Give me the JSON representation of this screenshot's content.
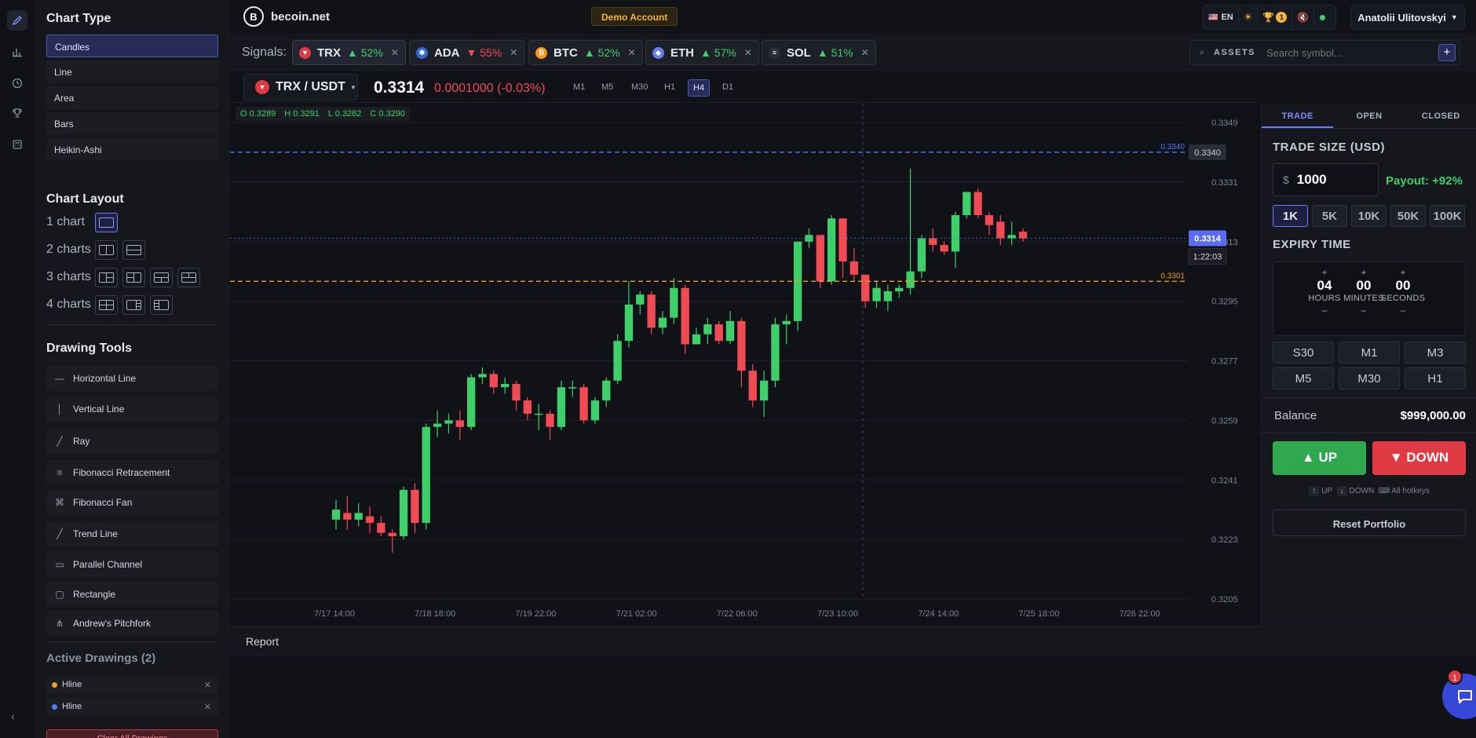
{
  "brand": {
    "name": "becoin.net",
    "logo_letter": "B"
  },
  "header": {
    "demo_label": "Demo Account",
    "language": "EN",
    "flag": "🇺🇸",
    "theme_icon": "sun-icon",
    "trophy_count": "1",
    "user_name": "Anatolii Ulitovskyi"
  },
  "left_rail": {
    "items": [
      "pencil-icon",
      "bar-chart-icon",
      "clock-icon",
      "trophy-icon",
      "calculator-icon"
    ]
  },
  "chart_type": {
    "title": "Chart Type",
    "items": [
      "Candles",
      "Line",
      "Area",
      "Bars",
      "Heikin-Ashi"
    ],
    "selected": "Candles"
  },
  "chart_layout": {
    "title": "Chart Layout",
    "rows": [
      "1 chart",
      "2 charts",
      "3 charts",
      "4 charts"
    ]
  },
  "drawing_tools": {
    "title": "Drawing Tools",
    "items": [
      {
        "label": "Horizontal Line",
        "icon": "—"
      },
      {
        "label": "Vertical Line",
        "icon": "│"
      },
      {
        "label": "Ray",
        "icon": "╱"
      },
      {
        "label": "Fibonacci Retracement",
        "icon": "≡"
      },
      {
        "label": "Fibonacci Fan",
        "icon": "⌘"
      },
      {
        "label": "Trend Line",
        "icon": "╱"
      },
      {
        "label": "Parallel Channel",
        "icon": "▭"
      },
      {
        "label": "Rectangle",
        "icon": "▢"
      },
      {
        "label": "Andrew's Pitchfork",
        "icon": "⋔"
      }
    ]
  },
  "active_drawings": {
    "title": "Active Drawings (2)",
    "items": [
      {
        "label": "Hline",
        "color": "#f0a020"
      },
      {
        "label": "Hline",
        "color": "#4a7dff"
      }
    ],
    "clear_label": "Clear All Drawings"
  },
  "signals": {
    "label": "Signals:",
    "chips": [
      {
        "symbol": "TRX",
        "pct": "52%",
        "dir": "up",
        "arrow": "▲",
        "color": "#e03b44",
        "glyph": "▼",
        "selected": true
      },
      {
        "symbol": "ADA",
        "pct": "55%",
        "dir": "down",
        "arrow": "▼",
        "color": "#3468d1",
        "glyph": "✱",
        "selected": false
      },
      {
        "symbol": "BTC",
        "pct": "52%",
        "dir": "up",
        "arrow": "▲",
        "color": "#f7931a",
        "glyph": "₿",
        "selected": false
      },
      {
        "symbol": "ETH",
        "pct": "57%",
        "dir": "up",
        "arrow": "▲",
        "color": "#627eea",
        "glyph": "◆",
        "selected": false
      },
      {
        "symbol": "SOL",
        "pct": "51%",
        "dir": "up",
        "arrow": "▲",
        "color": "#2a2d3a",
        "glyph": "≡",
        "selected": false
      }
    ]
  },
  "search": {
    "label": "ASSETS",
    "placeholder": "Search symbol..."
  },
  "pair": {
    "name": "TRX / USDT",
    "price": "0.3314",
    "change": "0.0001000 (-0.03%)",
    "timeframes": [
      "M1",
      "M5",
      "M30",
      "H1",
      "H4",
      "D1"
    ],
    "selected_tf": "H4"
  },
  "ohlc": {
    "o": "O 0.3289",
    "h": "H 0.3291",
    "l": "L 0.3282",
    "c": "C 0.3290"
  },
  "chart_data": {
    "type": "candlestick",
    "price_axis_ticks": [
      "0.3349",
      "0.3331",
      "0.3313",
      "0.3295",
      "0.3277",
      "0.3259",
      "0.3241",
      "0.3223",
      "0.3205"
    ],
    "time_axis_ticks": [
      "7/17 14:00",
      "7/18 18:00",
      "7/19 22:00",
      "7/21 02:00",
      "7/22 06:00",
      "7/23 10:00",
      "7/24 14:00",
      "7/25 18:00",
      "7/26 22:00"
    ],
    "y_range": [
      0.3205,
      0.3349
    ],
    "last_price": "0.3314",
    "countdown": "1:22:03",
    "hlines": [
      {
        "value": 0.334,
        "label": "0.3340",
        "color": "#4a7dff"
      },
      {
        "value": 0.3301,
        "label": "0.3301",
        "color": "#f0a020"
      }
    ],
    "candles": [
      [
        0.3229,
        0.3232,
        0.3235,
        0.3226
      ],
      [
        0.3231,
        0.3229,
        0.3236,
        0.3226
      ],
      [
        0.3229,
        0.3231,
        0.3234,
        0.3227
      ],
      [
        0.323,
        0.3228,
        0.3233,
        0.3225
      ],
      [
        0.3228,
        0.3225,
        0.323,
        0.3224
      ],
      [
        0.3225,
        0.3224,
        0.3226,
        0.3219
      ],
      [
        0.3224,
        0.3238,
        0.3239,
        0.3223
      ],
      [
        0.3238,
        0.3228,
        0.324,
        0.3225
      ],
      [
        0.3228,
        0.3257,
        0.3258,
        0.3226
      ],
      [
        0.3257,
        0.3258,
        0.3262,
        0.3254
      ],
      [
        0.3258,
        0.3259,
        0.3261,
        0.3255
      ],
      [
        0.3259,
        0.3257,
        0.3262,
        0.3253
      ],
      [
        0.3257,
        0.3272,
        0.3273,
        0.3256
      ],
      [
        0.3272,
        0.3273,
        0.3275,
        0.327
      ],
      [
        0.3273,
        0.3269,
        0.3274,
        0.3267
      ],
      [
        0.3269,
        0.327,
        0.3272,
        0.3267
      ],
      [
        0.327,
        0.3265,
        0.3271,
        0.3262
      ],
      [
        0.3265,
        0.3261,
        0.3266,
        0.3259
      ],
      [
        0.3261,
        0.3261,
        0.3264,
        0.3256
      ],
      [
        0.3261,
        0.3257,
        0.3262,
        0.3253
      ],
      [
        0.3257,
        0.3269,
        0.3271,
        0.3256
      ],
      [
        0.3269,
        0.3269,
        0.3271,
        0.3266
      ],
      [
        0.3269,
        0.3259,
        0.327,
        0.3258
      ],
      [
        0.3259,
        0.3265,
        0.3266,
        0.3258
      ],
      [
        0.3265,
        0.3271,
        0.3272,
        0.3263
      ],
      [
        0.3271,
        0.3283,
        0.3285,
        0.327
      ],
      [
        0.3283,
        0.3294,
        0.3301,
        0.3281
      ],
      [
        0.3294,
        0.3297,
        0.3298,
        0.3291
      ],
      [
        0.3297,
        0.3287,
        0.3298,
        0.3285
      ],
      [
        0.3287,
        0.329,
        0.3292,
        0.3285
      ],
      [
        0.329,
        0.3299,
        0.3302,
        0.3288
      ],
      [
        0.3299,
        0.3282,
        0.33,
        0.3279
      ],
      [
        0.3282,
        0.3285,
        0.3287,
        0.3283
      ],
      [
        0.3285,
        0.3288,
        0.329,
        0.3282
      ],
      [
        0.3288,
        0.3283,
        0.3289,
        0.3282
      ],
      [
        0.3283,
        0.3289,
        0.3292,
        0.3282
      ],
      [
        0.3289,
        0.3274,
        0.329,
        0.3269
      ],
      [
        0.3274,
        0.3265,
        0.3276,
        0.3263
      ],
      [
        0.3265,
        0.3271,
        0.3274,
        0.326
      ],
      [
        0.3271,
        0.3288,
        0.329,
        0.3269
      ],
      [
        0.3288,
        0.3289,
        0.3291,
        0.3282
      ],
      [
        0.3289,
        0.3313,
        0.3313,
        0.3286
      ],
      [
        0.3313,
        0.3315,
        0.3317,
        0.3311
      ],
      [
        0.3315,
        0.3301,
        0.3315,
        0.3299
      ],
      [
        0.3301,
        0.332,
        0.3321,
        0.33
      ],
      [
        0.332,
        0.3307,
        0.332,
        0.3302
      ],
      [
        0.3307,
        0.3303,
        0.3311,
        0.3301
      ],
      [
        0.3303,
        0.3295,
        0.3303,
        0.3293
      ],
      [
        0.3295,
        0.3299,
        0.3301,
        0.3293
      ],
      [
        0.3295,
        0.3298,
        0.33,
        0.3292
      ],
      [
        0.3298,
        0.3299,
        0.33,
        0.3296
      ],
      [
        0.3299,
        0.3304,
        0.3335,
        0.3297
      ],
      [
        0.3304,
        0.3314,
        0.3315,
        0.3302
      ],
      [
        0.3314,
        0.3312,
        0.3317,
        0.331
      ],
      [
        0.3312,
        0.331,
        0.3313,
        0.3309
      ],
      [
        0.331,
        0.3321,
        0.3322,
        0.3305
      ],
      [
        0.3321,
        0.3328,
        0.3328,
        0.332
      ],
      [
        0.3328,
        0.3321,
        0.3329,
        0.332
      ],
      [
        0.3321,
        0.3318,
        0.3322,
        0.3315
      ],
      [
        0.3319,
        0.3314,
        0.3321,
        0.3312
      ],
      [
        0.3314,
        0.3315,
        0.3319,
        0.3312
      ],
      [
        0.3316,
        0.3314,
        0.3317,
        0.3313
      ]
    ]
  },
  "trade_panel": {
    "tabs": [
      "TRADE",
      "OPEN",
      "CLOSED"
    ],
    "selected_tab": "TRADE",
    "size_title": "TRADE SIZE (USD)",
    "currency": "$",
    "amount": "1000",
    "payout": "Payout: +92%",
    "quick": [
      "1K",
      "5K",
      "10K",
      "50K",
      "100K"
    ],
    "selected_quick": "1K",
    "expiry_title": "EXPIRY TIME",
    "expiry": {
      "hours": "04",
      "minutes": "00",
      "seconds": "00",
      "hours_label": "HOURS",
      "minutes_label": "MINUTES",
      "seconds_label": "SECONDS",
      "plus": "+",
      "minus": "–"
    },
    "expiry_buttons": [
      "S30",
      "M1",
      "M3",
      "M5",
      "M30",
      "H1"
    ],
    "balance_label": "Balance",
    "balance_value": "$999,000.00",
    "up_label": "▲ UP",
    "down_label": "▼ DOWN",
    "hotkey_up_key": "↑",
    "hotkey_up": "UP",
    "hotkey_down_key": "↓",
    "hotkey_down": "DOWN",
    "hotkey_all": "⌨ All hotkeys",
    "reset_label": "Reset Portfolio"
  },
  "report": {
    "label": "Report"
  },
  "chat": {
    "badge": "1"
  },
  "colors": {
    "up": "#3ecf6a",
    "down": "#f04b55",
    "accent": "#6f7bff"
  }
}
